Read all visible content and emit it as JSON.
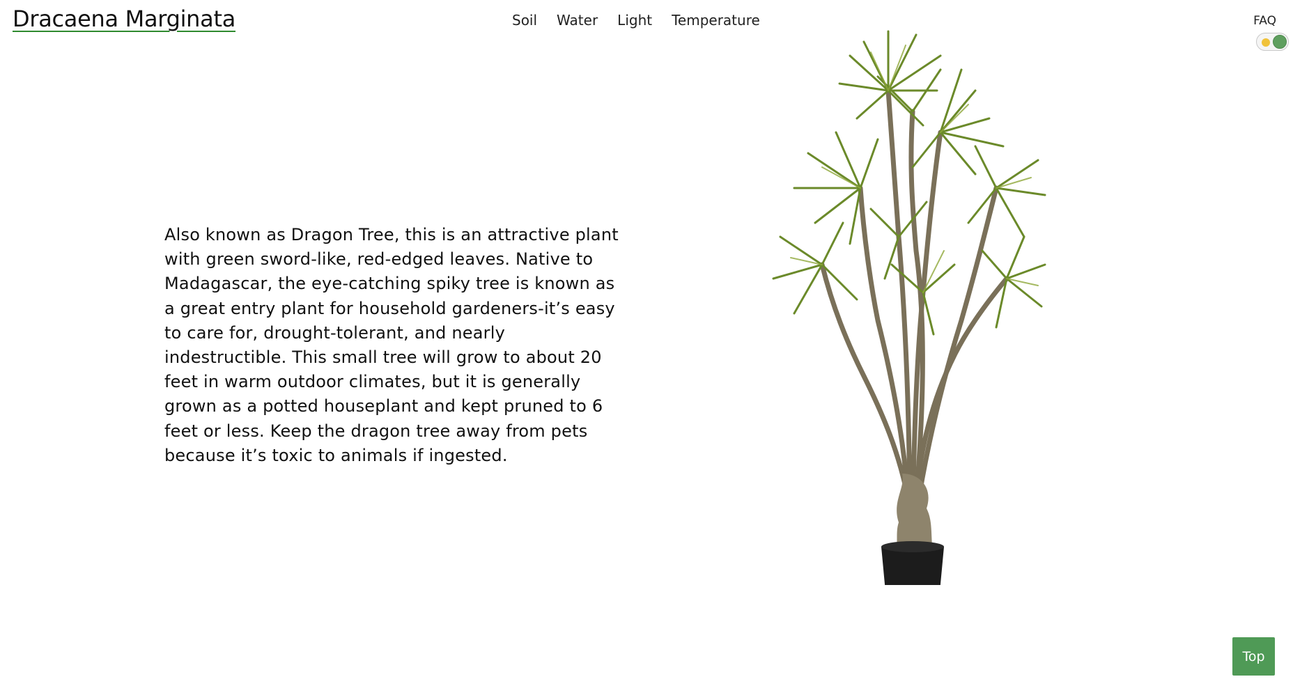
{
  "header": {
    "title": "Dracaena Marginata",
    "nav": [
      "Soil",
      "Water",
      "Light",
      "Temperature"
    ],
    "faq_label": "FAQ"
  },
  "theme_toggle": {
    "icon": "sun-icon",
    "accent_color": "#5f9f5f"
  },
  "main": {
    "description": "Also known as Dragon Tree, this is an attractive plant with green sword-like, red-edged leaves. Native to Madagascar, the eye-catching spiky tree is known as a great entry plant for household gardeners-it’s easy to care for, drought-tolerant, and nearly indestructible. This small tree will grow to about 20 feet in warm outdoor climates, but it is generally grown as a potted houseplant and kept pruned to 6 feet or less. Keep the dragon tree away from pets because it’s toxic to animals if ingested.",
    "image": "dracaena-plant-image"
  },
  "top_button": {
    "label": "Top",
    "color": "#4f9a56"
  },
  "colors": {
    "title_underline": "#2f8a2f",
    "leaf_green": "#6b8a2a",
    "pot": "#1c1c1c"
  }
}
